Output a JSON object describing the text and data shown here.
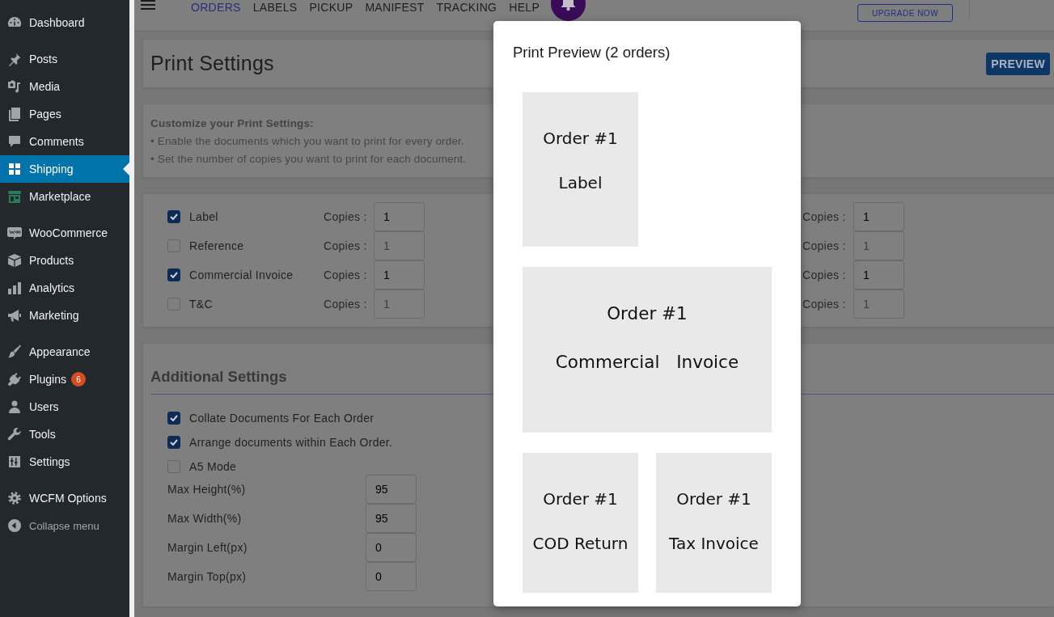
{
  "sidebar": {
    "groups": [
      {
        "items": [
          {
            "label": "Dashboard",
            "selected": false
          }
        ]
      },
      {
        "items": [
          {
            "label": "Posts",
            "selected": false
          },
          {
            "label": "Media",
            "selected": false
          },
          {
            "label": "Pages",
            "selected": false
          },
          {
            "label": "Comments",
            "selected": false
          },
          {
            "label": "Shipping",
            "selected": true
          },
          {
            "label": "Marketplace",
            "selected": false
          }
        ]
      },
      {
        "items": [
          {
            "label": "WooCommerce",
            "selected": false
          },
          {
            "label": "Products",
            "selected": false
          },
          {
            "label": "Analytics",
            "selected": false
          },
          {
            "label": "Marketing",
            "selected": false
          }
        ]
      },
      {
        "items": [
          {
            "label": "Appearance",
            "selected": false
          },
          {
            "label": "Plugins",
            "selected": false,
            "badge": "6"
          },
          {
            "label": "Users",
            "selected": false
          },
          {
            "label": "Tools",
            "selected": false
          },
          {
            "label": "Settings",
            "selected": false
          }
        ]
      },
      {
        "items": [
          {
            "label": "WCFM Options",
            "selected": false
          }
        ]
      }
    ],
    "collapse_label": "Collapse menu"
  },
  "top_nav": {
    "tabs": [
      {
        "label": "ORDERS",
        "selected": true
      },
      {
        "label": "LABELS",
        "selected": false
      },
      {
        "label": "PICKUP",
        "selected": false
      },
      {
        "label": "MANIFEST",
        "selected": false
      },
      {
        "label": "TRACKING",
        "selected": false
      },
      {
        "label": "HELP",
        "selected": false
      }
    ],
    "upgrade_button": "UPGRADE NOW"
  },
  "page_header": {
    "title": "Print Settings",
    "preview_button": "PREVIEW"
  },
  "info": {
    "heading": "Customize your Print Settings:",
    "bullets": [
      "• Enable the documents which you want to print for every order.",
      "• Set the number of copies you want to print for each document."
    ]
  },
  "documents": {
    "left": [
      {
        "label": "Label",
        "checked": true,
        "copies_label": "Copies :",
        "copies": {
          "value": "1",
          "disabled": false
        }
      },
      {
        "label": "Reference",
        "checked": false,
        "copies_label": "Copies :",
        "copies": {
          "value": "1",
          "disabled": true
        }
      },
      {
        "label": "Commercial Invoice",
        "checked": true,
        "copies_label": "Copies :",
        "copies": {
          "value": "1",
          "disabled": false
        }
      },
      {
        "label": "T&C",
        "checked": false,
        "copies_label": "Copies :",
        "copies": {
          "value": "1",
          "disabled": true
        }
      }
    ],
    "right": [
      {
        "copies_label": "Copies :",
        "copies": {
          "value": "1",
          "disabled": false
        }
      },
      {
        "copies_label": "Copies :",
        "copies": {
          "value": "1",
          "disabled": true
        }
      },
      {
        "copies_label": "Copies :",
        "copies": {
          "value": "1",
          "disabled": false
        }
      },
      {
        "copies_label": "Copies :",
        "copies": {
          "value": "1",
          "disabled": true
        }
      }
    ]
  },
  "additional_settings": {
    "title": "Additional Settings",
    "options": [
      {
        "label": "Collate Documents For Each Order",
        "checked": true
      },
      {
        "label": "Arrange documents within Each Order.",
        "checked": true
      },
      {
        "label": "A5 Mode",
        "checked": false
      }
    ],
    "fields": [
      {
        "label": "Max Height(%)",
        "value": "95"
      },
      {
        "label": "Max Width(%)",
        "value": "95"
      },
      {
        "label": "Margin Left(px)",
        "value": "0"
      },
      {
        "label": "Margin Top(px)",
        "value": "0"
      }
    ]
  },
  "print_preview": {
    "title": "Print Preview (2 orders)",
    "pages": [
      {
        "kind": "portrait",
        "order": "Order #1",
        "document": "Label"
      },
      {
        "kind": "landscape",
        "order": "Order #1",
        "document": "Commercial Invoice"
      },
      {
        "kind": "portrait",
        "order": "Order #1",
        "document": "COD Return"
      },
      {
        "kind": "portrait",
        "order": "Order #1",
        "document": "Tax Invoice"
      }
    ]
  }
}
